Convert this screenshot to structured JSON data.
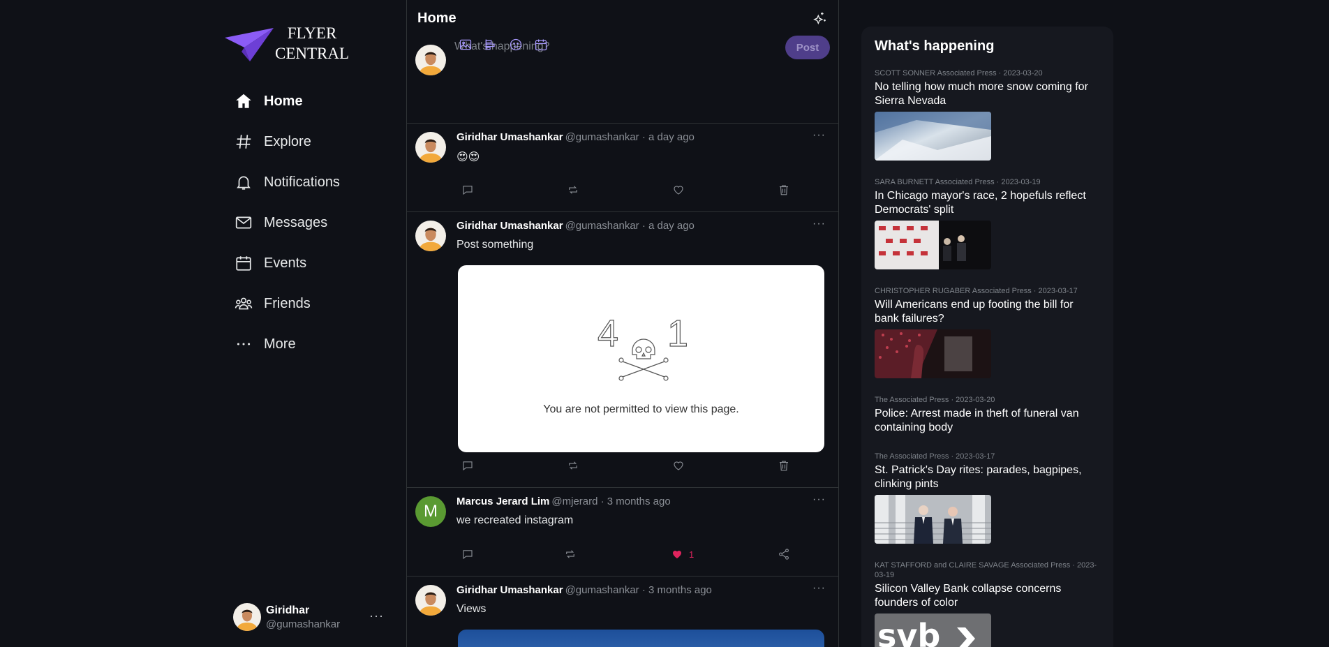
{
  "brand": {
    "line1": "FLYER",
    "line2": "CENTRAL",
    "accent": "#8b5cf6"
  },
  "nav": [
    {
      "label": "Home",
      "icon": "home-icon",
      "active": true
    },
    {
      "label": "Explore",
      "icon": "hashtag-icon"
    },
    {
      "label": "Notifications",
      "icon": "bell-icon"
    },
    {
      "label": "Messages",
      "icon": "envelope-icon"
    },
    {
      "label": "Events",
      "icon": "calendar-icon"
    },
    {
      "label": "Friends",
      "icon": "users-icon"
    },
    {
      "label": "More",
      "icon": "dots-icon"
    }
  ],
  "profile": {
    "name": "Giridhar",
    "handle": "@gumashankar"
  },
  "main": {
    "title": "Home",
    "composer": {
      "placeholder": "What's happening?",
      "post_label": "Post"
    }
  },
  "posts": [
    {
      "author": "Giridhar Umashankar",
      "meta": "@gumashankar · a day ago",
      "text": "😍😍"
    },
    {
      "author": "Giridhar Umashankar",
      "meta": "@gumashankar · a day ago",
      "text": "Post something",
      "embed": {
        "code_left": "4",
        "code_right": "1",
        "message": "You are not permitted to view this page."
      }
    },
    {
      "author": "Marcus Jerard Lim",
      "meta": "@mjerard · 3 months ago",
      "text": "we recreated instagram",
      "avatar_letter": "M",
      "likes": "1"
    },
    {
      "author": "Giridhar Umashankar",
      "meta": "@gumashankar · 3 months ago",
      "text": "Views"
    }
  ],
  "trends": {
    "title": "What's happening",
    "items": [
      {
        "meta": "SCOTT SONNER Associated Press · 2023-03-20",
        "title": "No telling how much more snow coming for Sierra Nevada"
      },
      {
        "meta": "SARA BURNETT Associated Press · 2023-03-19",
        "title": "In Chicago mayor's race, 2 hopefuls reflect Democrats' split"
      },
      {
        "meta": "CHRISTOPHER RUGABER Associated Press · 2023-03-17",
        "title": "Will Americans end up footing the bill for bank failures?"
      },
      {
        "meta": "The Associated Press · 2023-03-20",
        "title": "Police: Arrest made in theft of funeral van containing body"
      },
      {
        "meta": "The Associated Press · 2023-03-17",
        "title": "St. Patrick's Day rites: parades, bagpipes, clinking pints"
      },
      {
        "meta": "KAT STAFFORD and CLAIRE SAVAGE Associated Press · 2023-03-19",
        "title": "Silicon Valley Bank collapse concerns founders of color",
        "thumb_text": "svb"
      }
    ]
  }
}
